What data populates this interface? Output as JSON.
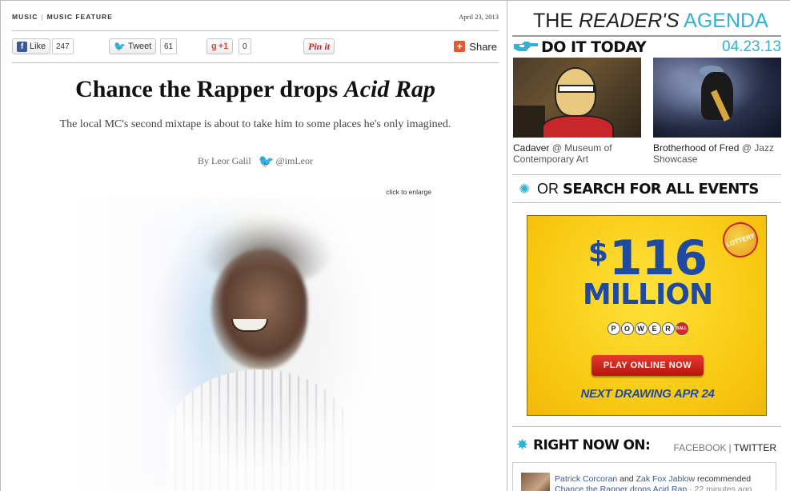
{
  "article": {
    "section": "MUSIC",
    "subsection": "MUSIC FEATURE",
    "date": "April 23, 2013",
    "share": {
      "like_label": "Like",
      "like_count": "247",
      "tweet_label": "Tweet",
      "tweet_count": "61",
      "gplus_label": "+1",
      "gplus_count": "0",
      "pin_label": "Pin it",
      "share_label": "Share"
    },
    "headline_plain": "Chance the Rapper drops ",
    "headline_italic": "Acid Rap",
    "dek": "The local MC's second mixtape is about to take him to some places he's only imagined.",
    "byline": "By Leor Galil",
    "twitter_handle": "@imLeor",
    "enlarge_label": "click to enlarge"
  },
  "sidebar": {
    "agenda": {
      "the": "THE ",
      "readers": "READER'S",
      "agenda": " AGENDA"
    },
    "do_it_today": "DO IT TODAY",
    "agenda_date": "04.23.13",
    "events": [
      {
        "title": "Cadaver",
        "venue": "@ Museum of Contemporary Art"
      },
      {
        "title": "Brotherhood of Fred",
        "venue": "@ Jazz Showcase"
      }
    ],
    "search": {
      "or": "OR ",
      "label": "SEARCH FOR ALL EVENTS"
    },
    "ad": {
      "logo": "LOTTERY",
      "dollar": "$",
      "amount": "116",
      "unit": "MILLION",
      "powerball_letters": [
        "P",
        "O",
        "W",
        "E",
        "R",
        "BALL"
      ],
      "cta": "PLAY ONLINE NOW",
      "next": "NEXT DRAWING APR 24"
    },
    "right_now": {
      "label": "RIGHT NOW ON:",
      "facebook": "FACEBOOK",
      "twitter": "TWITTER"
    },
    "feed": {
      "name1": "Patrick Corcoran",
      "and": " and ",
      "name2": "Zak Fox Jablow",
      "action": " recommended",
      "title": "Chance the Rapper drops Acid Rap",
      "ago": " · 22 minutes ago"
    }
  },
  "colors": {
    "accent": "#2fb2d6",
    "facebook": "#3b5998",
    "ad_blue": "#1f4aa1",
    "ad_yellow": "#f8c70f"
  }
}
